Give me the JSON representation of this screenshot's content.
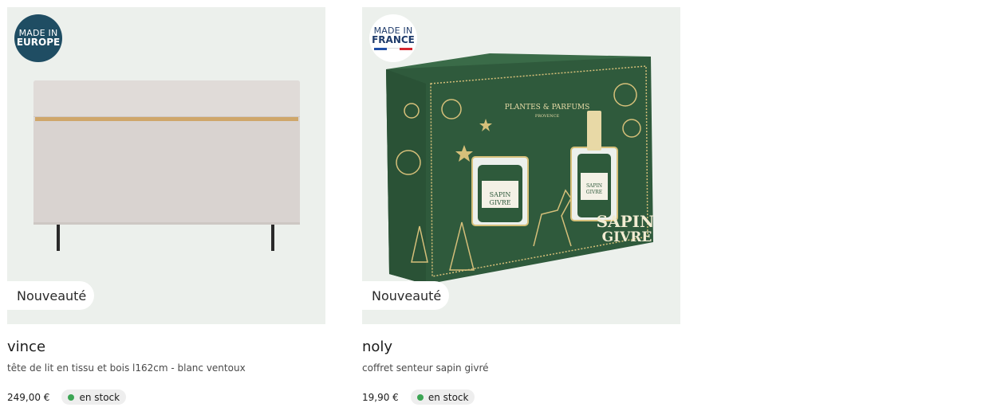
{
  "products": [
    {
      "badge": {
        "line1": "MADE IN",
        "line2": "EUROPE"
      },
      "new_label": "Nouveauté",
      "name": "vince",
      "description": "tête de lit en tissu et bois l162cm - blanc ventoux",
      "price": "249,00 €",
      "stock": "en stock"
    },
    {
      "badge": {
        "line1": "MADE IN",
        "line2": "FRANCE"
      },
      "new_label": "Nouveauté",
      "name": "noly",
      "description": "coffret senteur sapin givré",
      "price": "19,90 €",
      "stock": "en stock",
      "box_brand": "PLANTES & PARFUMS",
      "box_brand_sub": "PROVENCE",
      "box_title_1": "SAPIN",
      "box_title_2": "GIVRE"
    }
  ],
  "colors": {
    "image_bg": "#ecf0ec",
    "badge_europe": "#1f4d63",
    "stock_dot": "#3ca554",
    "box_green": "#2f5a3c",
    "gold": "#d6c07a"
  }
}
